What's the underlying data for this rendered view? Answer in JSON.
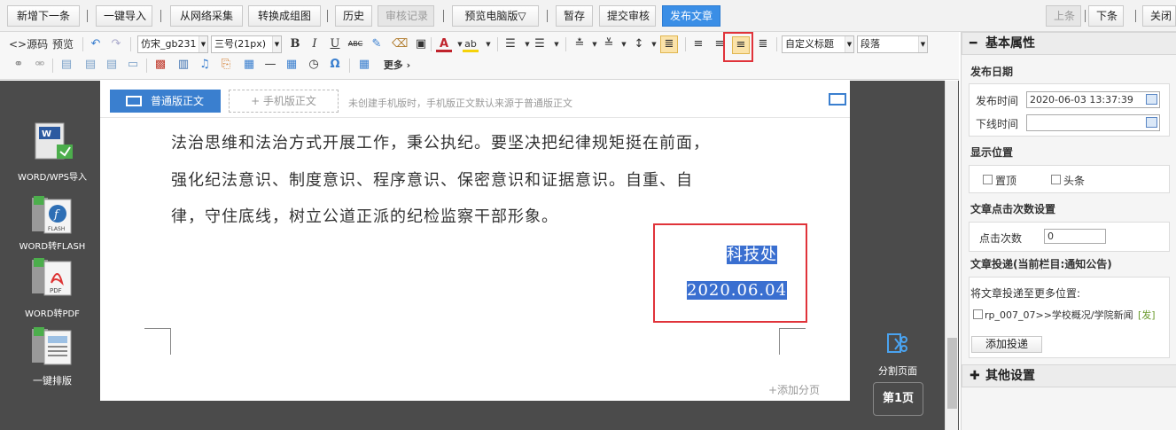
{
  "topbar": {
    "buttons": [
      "新增下一条",
      "一键导入",
      "从网络采集",
      "转换成组图",
      "历史",
      "审核记录",
      "预览电脑版▽",
      "暂存",
      "提交审核",
      "发布文章"
    ],
    "right_buttons": [
      "上条",
      "下条",
      "关闭"
    ]
  },
  "toolbar": {
    "source_label": "<>源码",
    "preview_label": "预览",
    "font_name": "仿宋_gb231",
    "font_size": "三号(21px)",
    "bold": "B",
    "italic": "I",
    "underline": "U",
    "strike": "ABC",
    "font_color": "A",
    "bg_color": "ab",
    "custom_title": "自定义标题",
    "paragraph": "段落",
    "more": "更多 ›"
  },
  "sidebar_tools": [
    {
      "label": "WORD/WPS导入"
    },
    {
      "label": "WORD转FLASH"
    },
    {
      "label": "WORD转PDF"
    },
    {
      "label": "一键排版"
    }
  ],
  "editor": {
    "pc_tab": "普通版正文",
    "mobile_tab": "+ 手机版正文",
    "tip": "未创建手机版时，手机版正文默认来源于普通版正文",
    "lines": [
      "法治思维和法治方式开展工作，秉公执纪。要坚决把纪律规矩挺在前面，",
      "强化纪法意识、制度意识、程序意识、保密意识和证据意识。自重、自",
      "律，守住底线，树立公道正派的纪检监察干部形象。"
    ],
    "signature": "科技处",
    "date": "2020.06.04",
    "add_page": "+添加分页"
  },
  "pager": {
    "split_label": "分割页面",
    "page_label": "第1页"
  },
  "panel": {
    "basic_title": "基本属性",
    "publish_date_label": "发布日期",
    "publish_time_label": "发布时间",
    "publish_time_value": "2020-06-03 13:37:39",
    "offline_time_label": "下线时间",
    "offline_time_value": "",
    "display_label": "显示位置",
    "top_label": "置顶",
    "headline_label": "头条",
    "clicks_section": "文章点击次数设置",
    "clicks_label": "点击次数",
    "clicks_value": "0",
    "delivery_section": "文章投递(当前栏目:通知公告)",
    "delivery_more": "将文章投递至更多位置:",
    "delivery_item": "rp_007_07>>学校概况/学院新闻",
    "delivery_tag": "[发]",
    "add_delivery": "添加投递",
    "other_title": "其他设置"
  },
  "colors": {
    "accent": "#3a8ee6",
    "highlight": "#3a6fd0",
    "annotation": "#e0333a"
  }
}
